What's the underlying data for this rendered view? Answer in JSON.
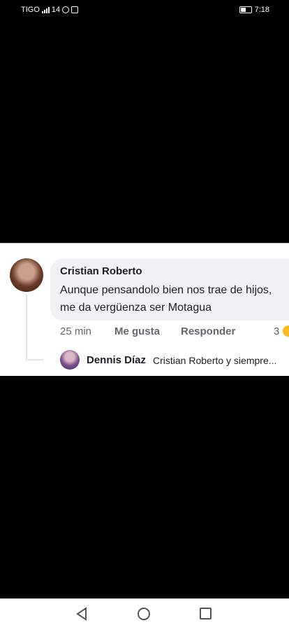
{
  "status_bar": {
    "carrier": "TIGO",
    "network": "14",
    "time": "7:18"
  },
  "comment": {
    "author": "Cristian Roberto",
    "text": "Aunque pensandolo bien nos trae de hijos, me da vergüenza ser Motagua",
    "time_ago": "25 min",
    "like_label": "Me gusta",
    "reply_label": "Responder",
    "reaction_count": "3"
  },
  "reply": {
    "author": "Dennis Díaz",
    "preview": "Cristian Roberto y siempre..."
  },
  "icons": {
    "avatar": "avatar",
    "nav_back": "back-triangle-icon",
    "nav_home": "home-circle-icon",
    "nav_recent": "recent-apps-square-icon"
  }
}
